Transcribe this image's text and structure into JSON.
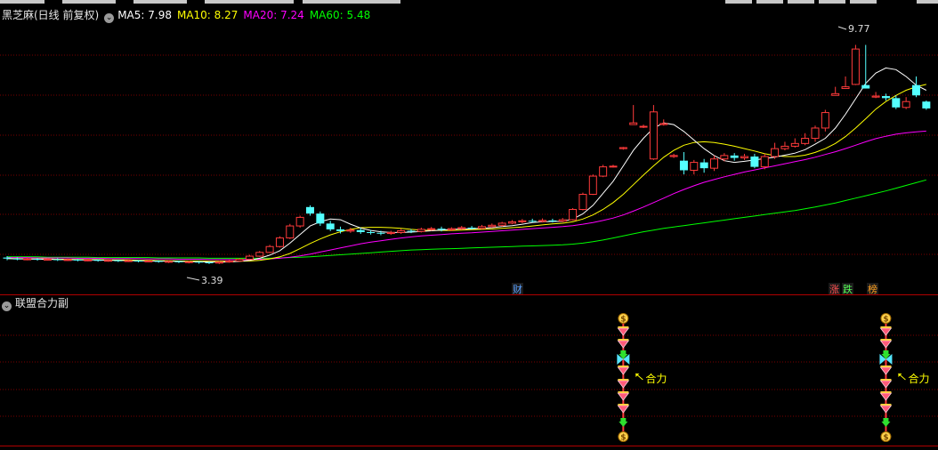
{
  "legend": {
    "title": "黑芝麻(日线 前复权)",
    "ma5": "MA5: 7.98",
    "ma10": "MA10: 8.27",
    "ma20": "MA20: 7.24",
    "ma60": "MA60: 5.48",
    "colors": {
      "ma5": "#ffffff",
      "ma10": "#ffff00",
      "ma20": "#ff00ff",
      "ma60": "#00ff00"
    }
  },
  "indicator_panel": {
    "title": "联盟合力副",
    "signal_label": "合力"
  },
  "markers": {
    "cai": "财",
    "zhang": "涨",
    "die": "跌",
    "bang": "榜"
  },
  "annotations": {
    "high": "9.77",
    "low": "3.39"
  },
  "chart_data": {
    "type": "candlestick",
    "price_range": [
      3.0,
      10.3
    ],
    "candles": [
      [
        3.58,
        3.55,
        3.62,
        3.5
      ],
      [
        3.55,
        3.53,
        3.59,
        3.5
      ],
      [
        3.53,
        3.54,
        3.58,
        3.5
      ],
      [
        3.54,
        3.52,
        3.57,
        3.49
      ],
      [
        3.52,
        3.53,
        3.56,
        3.49
      ],
      [
        3.53,
        3.51,
        3.56,
        3.48
      ],
      [
        3.51,
        3.52,
        3.55,
        3.48
      ],
      [
        3.52,
        3.5,
        3.54,
        3.47
      ],
      [
        3.5,
        3.51,
        3.54,
        3.47
      ],
      [
        3.51,
        3.49,
        3.53,
        3.46
      ],
      [
        3.49,
        3.5,
        3.53,
        3.46
      ],
      [
        3.5,
        3.48,
        3.52,
        3.45
      ],
      [
        3.48,
        3.49,
        3.52,
        3.45
      ],
      [
        3.49,
        3.47,
        3.51,
        3.44
      ],
      [
        3.47,
        3.48,
        3.51,
        3.44
      ],
      [
        3.48,
        3.46,
        3.5,
        3.43
      ],
      [
        3.46,
        3.47,
        3.5,
        3.42
      ],
      [
        3.47,
        3.45,
        3.49,
        3.42
      ],
      [
        3.45,
        3.46,
        3.49,
        3.41
      ],
      [
        3.46,
        3.44,
        3.48,
        3.4
      ],
      [
        3.44,
        3.42,
        3.47,
        3.39
      ],
      [
        3.42,
        3.45,
        3.48,
        3.39
      ],
      [
        3.45,
        3.48,
        3.52,
        3.43
      ],
      [
        3.48,
        3.53,
        3.56,
        3.46
      ],
      [
        3.53,
        3.62,
        3.66,
        3.51
      ],
      [
        3.62,
        3.73,
        3.77,
        3.6
      ],
      [
        3.73,
        3.9,
        3.95,
        3.71
      ],
      [
        3.9,
        4.15,
        4.2,
        3.87
      ],
      [
        4.15,
        4.5,
        4.56,
        4.12
      ],
      [
        4.5,
        4.75,
        4.8,
        4.45
      ],
      [
        5.05,
        4.86,
        5.1,
        4.8
      ],
      [
        4.86,
        4.57,
        4.92,
        4.5
      ],
      [
        4.57,
        4.4,
        4.65,
        4.35
      ],
      [
        4.4,
        4.35,
        4.48,
        4.28
      ],
      [
        4.35,
        4.38,
        4.45,
        4.3
      ],
      [
        4.38,
        4.32,
        4.44,
        4.27
      ],
      [
        4.32,
        4.3,
        4.38,
        4.25
      ],
      [
        4.3,
        4.28,
        4.36,
        4.23
      ],
      [
        4.28,
        4.31,
        4.36,
        4.24
      ],
      [
        4.31,
        4.36,
        4.42,
        4.27
      ],
      [
        4.36,
        4.34,
        4.41,
        4.29
      ],
      [
        4.34,
        4.4,
        4.45,
        4.31
      ],
      [
        4.4,
        4.42,
        4.47,
        4.36
      ],
      [
        4.42,
        4.39,
        4.48,
        4.34
      ],
      [
        4.39,
        4.42,
        4.46,
        4.35
      ],
      [
        4.42,
        4.45,
        4.5,
        4.38
      ],
      [
        4.45,
        4.43,
        4.5,
        4.39
      ],
      [
        4.43,
        4.48,
        4.53,
        4.4
      ],
      [
        4.48,
        4.52,
        4.57,
        4.45
      ],
      [
        4.52,
        4.58,
        4.62,
        4.48
      ],
      [
        4.58,
        4.62,
        4.67,
        4.55
      ],
      [
        4.62,
        4.65,
        4.7,
        4.58
      ],
      [
        4.65,
        4.63,
        4.71,
        4.6
      ],
      [
        4.63,
        4.66,
        4.72,
        4.6
      ],
      [
        4.66,
        4.64,
        4.71,
        4.6
      ],
      [
        4.64,
        4.68,
        4.73,
        4.61
      ],
      [
        4.68,
        4.98,
        5.02,
        4.66
      ],
      [
        4.98,
        5.42,
        5.47,
        4.95
      ],
      [
        5.42,
        5.95,
        6.0,
        5.4
      ],
      [
        5.95,
        6.22,
        6.28,
        5.92
      ],
      [
        6.22,
        6.24,
        6.28,
        6.2
      ],
      [
        6.75,
        6.78,
        6.8,
        6.72
      ],
      [
        7.45,
        7.5,
        8.02,
        7.45
      ],
      [
        7.38,
        7.4,
        7.45,
        7.35
      ],
      [
        6.45,
        7.82,
        8.02,
        6.42
      ],
      [
        7.45,
        7.48,
        7.6,
        7.42
      ],
      [
        6.52,
        6.55,
        6.6,
        6.48
      ],
      [
        6.4,
        6.12,
        6.65,
        6.0
      ],
      [
        6.12,
        6.35,
        6.42,
        6.0
      ],
      [
        6.35,
        6.18,
        6.45,
        6.05
      ],
      [
        6.18,
        6.45,
        6.55,
        6.1
      ],
      [
        6.45,
        6.55,
        6.62,
        6.38
      ],
      [
        6.55,
        6.48,
        6.62,
        6.4
      ],
      [
        6.48,
        6.52,
        6.6,
        6.42
      ],
      [
        6.52,
        6.22,
        6.6,
        6.18
      ],
      [
        6.22,
        6.52,
        6.6,
        6.15
      ],
      [
        6.52,
        6.75,
        6.92,
        6.45
      ],
      [
        6.75,
        6.82,
        6.95,
        6.7
      ],
      [
        6.82,
        6.9,
        7.05,
        6.78
      ],
      [
        6.9,
        7.05,
        7.2,
        6.85
      ],
      [
        7.05,
        7.35,
        7.42,
        6.95
      ],
      [
        7.35,
        7.8,
        7.88,
        7.25
      ],
      [
        8.3,
        8.35,
        8.55,
        8.3
      ],
      [
        8.5,
        8.55,
        8.85,
        8.5
      ],
      [
        8.62,
        9.65,
        9.77,
        8.6
      ],
      [
        8.6,
        8.5,
        9.77,
        8.5
      ],
      [
        8.25,
        8.28,
        8.4,
        8.22
      ],
      [
        8.28,
        8.22,
        8.35,
        8.15
      ],
      [
        8.22,
        7.95,
        8.3,
        7.9
      ],
      [
        7.95,
        8.12,
        8.25,
        7.9
      ],
      [
        8.6,
        8.3,
        8.85,
        8.25
      ],
      [
        8.12,
        7.92,
        8.15,
        7.88
      ]
    ],
    "ma5": [
      3.55,
      3.54,
      3.54,
      3.53,
      3.53,
      3.52,
      3.52,
      3.51,
      3.51,
      3.51,
      3.5,
      3.5,
      3.49,
      3.49,
      3.48,
      3.48,
      3.47,
      3.47,
      3.46,
      3.46,
      3.45,
      3.45,
      3.45,
      3.47,
      3.5,
      3.56,
      3.65,
      3.78,
      4.0,
      4.25,
      4.5,
      4.62,
      4.7,
      4.68,
      4.55,
      4.44,
      4.37,
      4.33,
      4.31,
      4.31,
      4.32,
      4.34,
      4.36,
      4.38,
      4.4,
      4.41,
      4.42,
      4.43,
      4.45,
      4.48,
      4.51,
      4.55,
      4.6,
      4.62,
      4.63,
      4.63,
      4.7,
      4.85,
      5.1,
      5.45,
      5.8,
      6.25,
      6.7,
      7.05,
      7.35,
      7.5,
      7.45,
      7.25,
      7.0,
      6.75,
      6.55,
      6.4,
      6.35,
      6.38,
      6.42,
      6.46,
      6.5,
      6.56,
      6.62,
      6.72,
      6.88,
      7.05,
      7.35,
      7.75,
      8.2,
      8.65,
      8.95,
      9.1,
      9.05,
      8.85,
      8.6,
      8.45
    ],
    "ma10": [
      3.55,
      3.55,
      3.54,
      3.54,
      3.54,
      3.53,
      3.53,
      3.52,
      3.52,
      3.52,
      3.51,
      3.51,
      3.51,
      3.5,
      3.5,
      3.49,
      3.49,
      3.48,
      3.48,
      3.48,
      3.47,
      3.47,
      3.47,
      3.47,
      3.48,
      3.5,
      3.54,
      3.6,
      3.7,
      3.84,
      3.99,
      4.12,
      4.24,
      4.33,
      4.4,
      4.45,
      4.46,
      4.46,
      4.45,
      4.43,
      4.4,
      4.38,
      4.37,
      4.37,
      4.37,
      4.38,
      4.39,
      4.4,
      4.41,
      4.43,
      4.45,
      4.47,
      4.5,
      4.53,
      4.56,
      4.58,
      4.62,
      4.7,
      4.82,
      4.98,
      5.18,
      5.42,
      5.7,
      5.98,
      6.25,
      6.5,
      6.7,
      6.85,
      6.93,
      6.95,
      6.93,
      6.88,
      6.82,
      6.75,
      6.68,
      6.6,
      6.55,
      6.52,
      6.52,
      6.56,
      6.64,
      6.75,
      6.9,
      7.1,
      7.35,
      7.62,
      7.9,
      8.12,
      8.3,
      8.45,
      8.55,
      8.62
    ],
    "ma20": [
      3.58,
      3.58,
      3.58,
      3.57,
      3.57,
      3.57,
      3.57,
      3.56,
      3.56,
      3.56,
      3.55,
      3.55,
      3.55,
      3.55,
      3.54,
      3.54,
      3.54,
      3.53,
      3.53,
      3.53,
      3.52,
      3.52,
      3.52,
      3.52,
      3.52,
      3.53,
      3.54,
      3.56,
      3.59,
      3.63,
      3.68,
      3.74,
      3.8,
      3.86,
      3.92,
      3.98,
      4.03,
      4.07,
      4.11,
      4.15,
      4.18,
      4.21,
      4.23,
      4.25,
      4.27,
      4.29,
      4.3,
      4.32,
      4.34,
      4.36,
      4.38,
      4.4,
      4.42,
      4.44,
      4.46,
      4.48,
      4.51,
      4.55,
      4.6,
      4.66,
      4.73,
      4.82,
      4.93,
      5.05,
      5.18,
      5.31,
      5.44,
      5.56,
      5.67,
      5.77,
      5.85,
      5.93,
      6.0,
      6.07,
      6.13,
      6.19,
      6.25,
      6.31,
      6.37,
      6.43,
      6.5,
      6.58,
      6.66,
      6.75,
      6.85,
      6.95,
      7.04,
      7.11,
      7.17,
      7.21,
      7.24,
      7.26
    ],
    "ma60": [
      3.6,
      3.6,
      3.6,
      3.6,
      3.59,
      3.59,
      3.59,
      3.59,
      3.59,
      3.58,
      3.58,
      3.58,
      3.58,
      3.58,
      3.58,
      3.57,
      3.57,
      3.57,
      3.57,
      3.57,
      3.56,
      3.56,
      3.56,
      3.56,
      3.56,
      3.56,
      3.56,
      3.57,
      3.58,
      3.59,
      3.6,
      3.62,
      3.64,
      3.66,
      3.68,
      3.7,
      3.72,
      3.74,
      3.76,
      3.78,
      3.8,
      3.81,
      3.82,
      3.83,
      3.84,
      3.85,
      3.86,
      3.87,
      3.88,
      3.89,
      3.9,
      3.91,
      3.92,
      3.93,
      3.94,
      3.95,
      3.97,
      4.0,
      4.04,
      4.09,
      4.15,
      4.21,
      4.27,
      4.33,
      4.38,
      4.43,
      4.47,
      4.51,
      4.55,
      4.59,
      4.63,
      4.67,
      4.71,
      4.75,
      4.79,
      4.83,
      4.87,
      4.91,
      4.95,
      5.0,
      5.05,
      5.11,
      5.17,
      5.24,
      5.31,
      5.38,
      5.45,
      5.52,
      5.6,
      5.68,
      5.76,
      5.84
    ],
    "signals": [
      {
        "candle": 61
      },
      {
        "candle": 87
      }
    ]
  }
}
